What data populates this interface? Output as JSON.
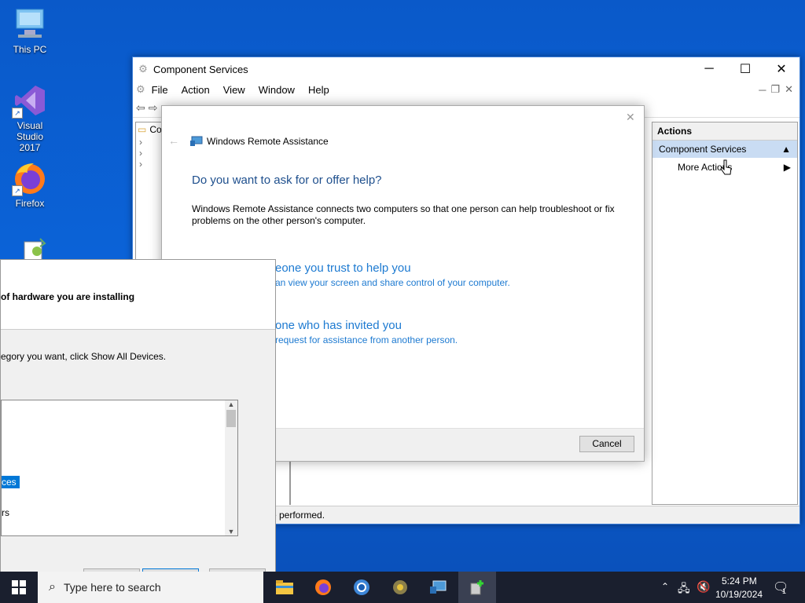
{
  "desktop": {
    "icons": [
      {
        "label": "This PC"
      },
      {
        "label": "Visual Studio 2017"
      },
      {
        "label": "Firefox"
      }
    ]
  },
  "component_services": {
    "title": "Component Services",
    "menu": [
      "File",
      "Action",
      "View",
      "Window",
      "Help"
    ],
    "tree_visible_text": "Co",
    "actions": {
      "header": "Actions",
      "selected": "Component Services",
      "more": "More Actions"
    },
    "status_text": "e performed."
  },
  "remote_assistance": {
    "title": "Windows Remote Assistance",
    "heading": "Do you want to ask for or offer help?",
    "description": "Windows Remote Assistance connects two computers so that one person can help troubleshoot or fix problems on the other person's computer.",
    "option1_title": "eone you trust to help you",
    "option1_sub": "an view your screen and share control of your computer.",
    "option2_title": "one who has invited you",
    "option2_sub": "request for assistance from another person.",
    "cancel": "Cancel"
  },
  "hardware_wizard": {
    "heading": "of hardware you are installing",
    "instruction": "egory you want, click Show All Devices.",
    "list_items": [
      "ces",
      "rs"
    ]
  },
  "taskbar": {
    "search_placeholder": "Type here to search",
    "time": "5:24 PM",
    "date": "10/19/2024",
    "notification_count": "1"
  }
}
